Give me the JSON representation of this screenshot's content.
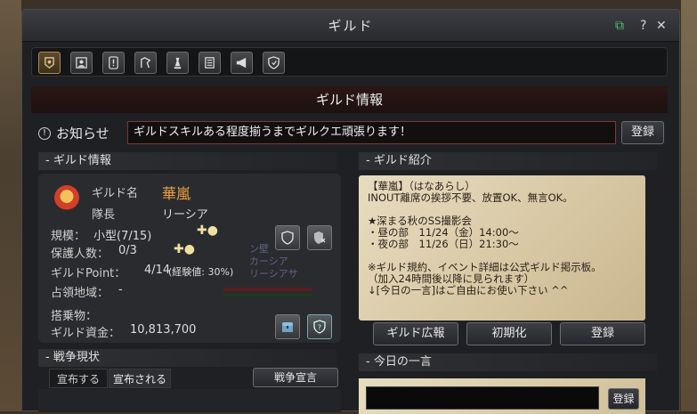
{
  "window": {
    "title": "ギルド"
  },
  "tabs": [
    {
      "name": "guild-info-tab-icon",
      "active": true
    },
    {
      "name": "members-tab-icon",
      "active": false
    },
    {
      "name": "notice-tab-icon",
      "active": false
    },
    {
      "name": "skills-tab-icon",
      "active": false
    },
    {
      "name": "chess-tab-icon",
      "active": false
    },
    {
      "name": "board-tab-icon",
      "active": false
    },
    {
      "name": "megaphone-tab-icon",
      "active": false
    },
    {
      "name": "shield-tab-icon",
      "active": false
    }
  ],
  "header": "ギルド情報",
  "notice": {
    "label": "お知らせ",
    "text": "ギルドスキルある程度揃うまでギルクエ頑張ります！",
    "register": "登録"
  },
  "guild_info": {
    "section": "- ギルド情報",
    "name_label": "ギルド名",
    "name": "華嵐",
    "leader_label": "隊長",
    "leader": "リーシア",
    "scale_label": "規模：",
    "scale": "小型(7/15)",
    "protect_label": "保護人数：",
    "protect": "0/3",
    "point_label": "ギルドPoint：",
    "point": "4/14",
    "point_exp": "(経験値: 30%)",
    "territory_label": "占領地域：",
    "territory": "-",
    "mount_label": "搭乗物：",
    "mount": "",
    "funds_label": "ギルド資金：",
    "funds": "10,813,700"
  },
  "overlay": [
    "ン壁",
    "カーシア",
    "リーシアサ"
  ],
  "war": {
    "section": "- 戦争現状",
    "tab_declare": "宣布する",
    "tab_declared": "宣布される",
    "declare_button": "戦争宣言"
  },
  "intro": {
    "section": "- ギルド紹介",
    "text": "【華嵐】（はなあらし）\nINOUT離席の挨拶不要、放置OK、無言OK。\n\n★深まる秋のSS撮影会\n・昼の部　11/24（金）14:00～\n・夜の部　11/26（日）21:30～\n\n※ギルド規約、イベント詳細は公式ギルド掲示板。\n（加入24時間後以降に見られます）\n↓[今日の一言]はご自由にお使い下さい ^^",
    "promo_button": "ギルド広報",
    "reset_button": "初期化",
    "register_button": "登録"
  },
  "today": {
    "section": "- 今日の一言",
    "register_button": "登録",
    "value": ""
  }
}
